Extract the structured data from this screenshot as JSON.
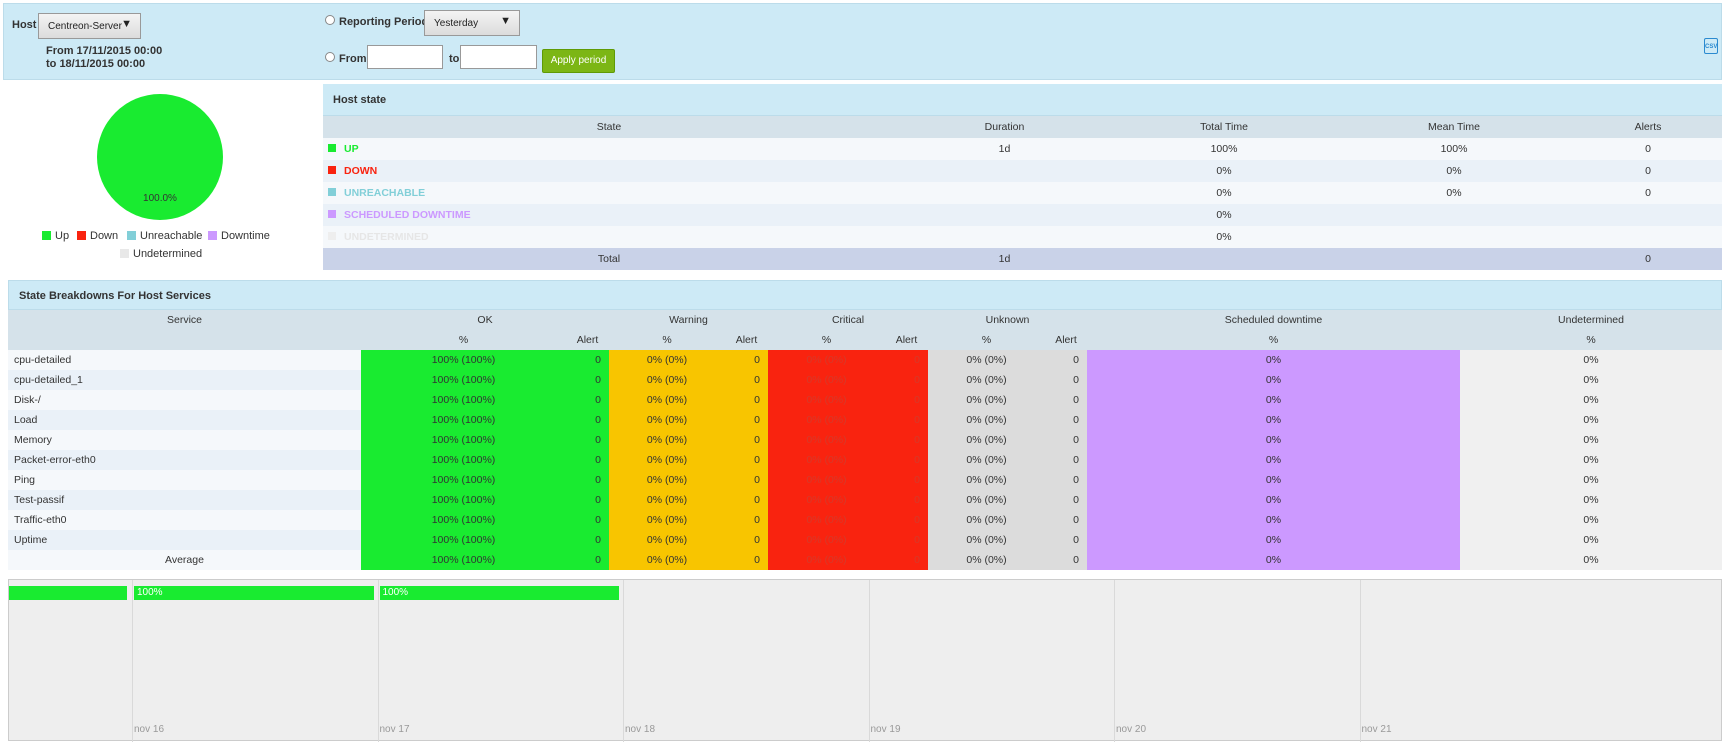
{
  "filter": {
    "host_label": "Host",
    "host_value": "Centreon-Server",
    "from_line": "From 17/11/2015 00:00",
    "to_line": "to 18/11/2015 00:00",
    "reporting_period_label": "Reporting Period",
    "reporting_period_value": "Yesterday",
    "from_label": "From",
    "to_label": "to",
    "apply_label": "Apply period",
    "export_icon": "csv-export-icon"
  },
  "pie": {
    "value_label": "100.0%",
    "slices": [
      {
        "name": "Up",
        "percent": 100,
        "color": "#19eb30"
      }
    ],
    "legend": [
      {
        "label": "Up",
        "color": "#19eb30"
      },
      {
        "label": "Down",
        "color": "#f9230f"
      },
      {
        "label": "Unreachable",
        "color": "#82cfd8"
      },
      {
        "label": "Downtime",
        "color": "#cc99ff"
      },
      {
        "label": "Undetermined",
        "color": "#e8e8e8"
      }
    ]
  },
  "host_state": {
    "title": "Host state",
    "columns": [
      "State",
      "Duration",
      "Total Time",
      "Mean Time",
      "Alerts"
    ],
    "rows": [
      {
        "state": "UP",
        "color": "#19eb30",
        "duration": "1d",
        "total": "100%",
        "mean": "100%",
        "alerts": "0"
      },
      {
        "state": "DOWN",
        "color": "#f9230f",
        "duration": "",
        "total": "0%",
        "mean": "0%",
        "alerts": "0"
      },
      {
        "state": "UNREACHABLE",
        "color": "#82cfd8",
        "duration": "",
        "total": "0%",
        "mean": "0%",
        "alerts": "0"
      },
      {
        "state": "SCHEDULED DOWNTIME",
        "color": "#cc99ff",
        "duration": "",
        "total": "0%",
        "mean": "",
        "alerts": ""
      },
      {
        "state": "UNDETERMINED",
        "color": "#eeeeee",
        "duration": "",
        "total": "0%",
        "mean": "",
        "alerts": ""
      }
    ],
    "total": {
      "label": "Total",
      "duration": "1d",
      "alerts": "0"
    }
  },
  "breakdown": {
    "title": "State Breakdowns For Host Services",
    "groups": [
      "Service",
      "OK",
      "Warning",
      "Critical",
      "Unknown",
      "Scheduled downtime",
      "Undetermined"
    ],
    "sub": {
      "pct": "%",
      "alert": "Alert"
    },
    "rows": [
      {
        "name": "cpu-detailed",
        "ok": "100% (100%)",
        "ok_a": "0",
        "wa": "0% (0%)",
        "wa_a": "0",
        "cr": "0% (0%)",
        "cr_a": "0",
        "un": "0% (0%)",
        "un_a": "0",
        "sd": "0%",
        "ud": "0%"
      },
      {
        "name": "cpu-detailed_1",
        "ok": "100% (100%)",
        "ok_a": "0",
        "wa": "0% (0%)",
        "wa_a": "0",
        "cr": "0% (0%)",
        "cr_a": "0",
        "un": "0% (0%)",
        "un_a": "0",
        "sd": "0%",
        "ud": "0%"
      },
      {
        "name": "Disk-/",
        "ok": "100% (100%)",
        "ok_a": "0",
        "wa": "0% (0%)",
        "wa_a": "0",
        "cr": "0% (0%)",
        "cr_a": "0",
        "un": "0% (0%)",
        "un_a": "0",
        "sd": "0%",
        "ud": "0%"
      },
      {
        "name": "Load",
        "ok": "100% (100%)",
        "ok_a": "0",
        "wa": "0% (0%)",
        "wa_a": "0",
        "cr": "0% (0%)",
        "cr_a": "0",
        "un": "0% (0%)",
        "un_a": "0",
        "sd": "0%",
        "ud": "0%"
      },
      {
        "name": "Memory",
        "ok": "100% (100%)",
        "ok_a": "0",
        "wa": "0% (0%)",
        "wa_a": "0",
        "cr": "0% (0%)",
        "cr_a": "0",
        "un": "0% (0%)",
        "un_a": "0",
        "sd": "0%",
        "ud": "0%"
      },
      {
        "name": "Packet-error-eth0",
        "ok": "100% (100%)",
        "ok_a": "0",
        "wa": "0% (0%)",
        "wa_a": "0",
        "cr": "0% (0%)",
        "cr_a": "0",
        "un": "0% (0%)",
        "un_a": "0",
        "sd": "0%",
        "ud": "0%"
      },
      {
        "name": "Ping",
        "ok": "100% (100%)",
        "ok_a": "0",
        "wa": "0% (0%)",
        "wa_a": "0",
        "cr": "0% (0%)",
        "cr_a": "0",
        "un": "0% (0%)",
        "un_a": "0",
        "sd": "0%",
        "ud": "0%"
      },
      {
        "name": "Test-passif",
        "ok": "100% (100%)",
        "ok_a": "0",
        "wa": "0% (0%)",
        "wa_a": "0",
        "cr": "0% (0%)",
        "cr_a": "0",
        "un": "0% (0%)",
        "un_a": "0",
        "sd": "0%",
        "ud": "0%"
      },
      {
        "name": "Traffic-eth0",
        "ok": "100% (100%)",
        "ok_a": "0",
        "wa": "0% (0%)",
        "wa_a": "0",
        "cr": "0% (0%)",
        "cr_a": "0",
        "un": "0% (0%)",
        "un_a": "0",
        "sd": "0%",
        "ud": "0%"
      },
      {
        "name": "Uptime",
        "ok": "100% (100%)",
        "ok_a": "0",
        "wa": "0% (0%)",
        "wa_a": "0",
        "cr": "0% (0%)",
        "cr_a": "0",
        "un": "0% (0%)",
        "un_a": "0",
        "sd": "0%",
        "ud": "0%"
      }
    ],
    "average": {
      "name": "Average",
      "ok": "100% (100%)",
      "ok_a": "0",
      "wa": "0% (0%)",
      "wa_a": "0",
      "cr": "0% (0%)",
      "cr_a": "0",
      "un": "0% (0%)",
      "un_a": "0",
      "sd": "0%",
      "ud": "0%"
    }
  },
  "timeline": {
    "days": [
      "nov 16",
      "nov 17",
      "nov 18",
      "nov 19",
      "nov 20",
      "nov 21"
    ],
    "bars": [
      {
        "label": "",
        "percent": 100
      },
      {
        "label": "100%",
        "percent": 100
      },
      {
        "label": "100%",
        "percent": 100
      }
    ]
  }
}
